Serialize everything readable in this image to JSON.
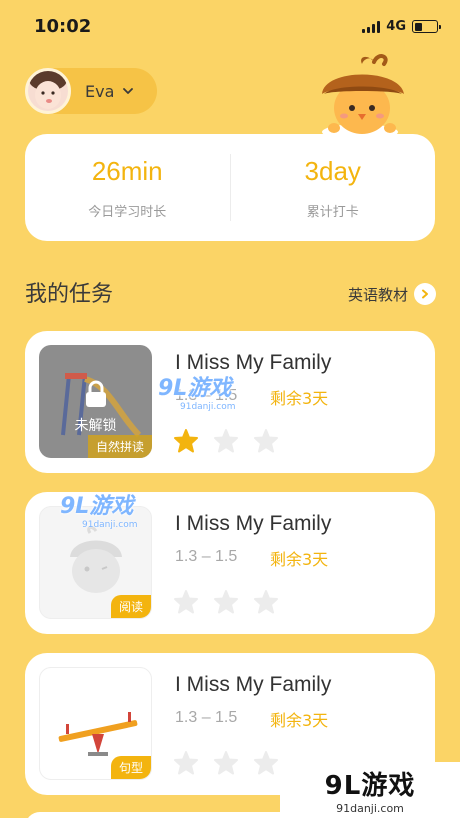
{
  "status_bar": {
    "time": "10:02",
    "network": "4G"
  },
  "profile": {
    "name": "Eva"
  },
  "stats": [
    {
      "value": "26min",
      "label": "今日学习时长"
    },
    {
      "value": "3day",
      "label": "累计打卡"
    }
  ],
  "section": {
    "title": "我的任务",
    "link_label": "英语教材"
  },
  "tasks": [
    {
      "title": "I Miss My Family",
      "range": "1.3 – 1.5",
      "remaining": "剩余3天",
      "tag": "自然拼读",
      "locked": true,
      "lock_label": "未解锁",
      "stars_earned": 1,
      "stars_total": 3
    },
    {
      "title": "I Miss My Family",
      "range": "1.3 – 1.5",
      "remaining": "剩余3天",
      "tag": "阅读",
      "locked": false,
      "stars_earned": 0,
      "stars_total": 3
    },
    {
      "title": "I Miss My Family",
      "range": "1.3 – 1.5",
      "remaining": "剩余3天",
      "tag": "句型",
      "locked": false,
      "stars_earned": 0,
      "stars_total": 3
    }
  ],
  "watermark": {
    "brand": "9L游戏",
    "site": "91danji.com"
  },
  "colors": {
    "background": "#fbd466",
    "accent": "#f3b40f",
    "card": "#ffffff"
  }
}
